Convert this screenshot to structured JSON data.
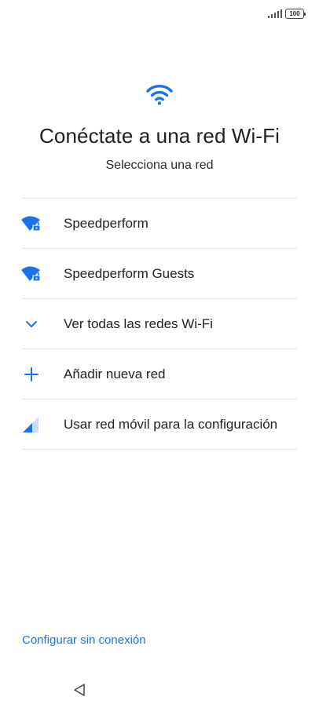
{
  "status_bar": {
    "battery_level": "100",
    "signal_icon": "cellular-signal-icon"
  },
  "header": {
    "hero_icon": "wifi-icon",
    "title": "Conéctate a una red Wi-Fi",
    "subtitle": "Selecciona una red"
  },
  "networks": [
    {
      "label": "Speedperform",
      "icon": "wifi-lock-icon"
    },
    {
      "label": "Speedperform Guests",
      "icon": "wifi-lock-icon"
    },
    {
      "label": "Ver todas las redes Wi-Fi",
      "icon": "chevron-down-icon"
    },
    {
      "label": "Añadir nueva red",
      "icon": "plus-icon"
    },
    {
      "label": "Usar red móvil para la configuración",
      "icon": "mobile-signal-icon"
    }
  ],
  "footer": {
    "offline_label": "Configurar sin conexión",
    "nav_back_icon": "back-triangle-icon"
  },
  "colors": {
    "accent": "#1a73e8",
    "divider": "#e2e2e2",
    "text": "#202124"
  }
}
